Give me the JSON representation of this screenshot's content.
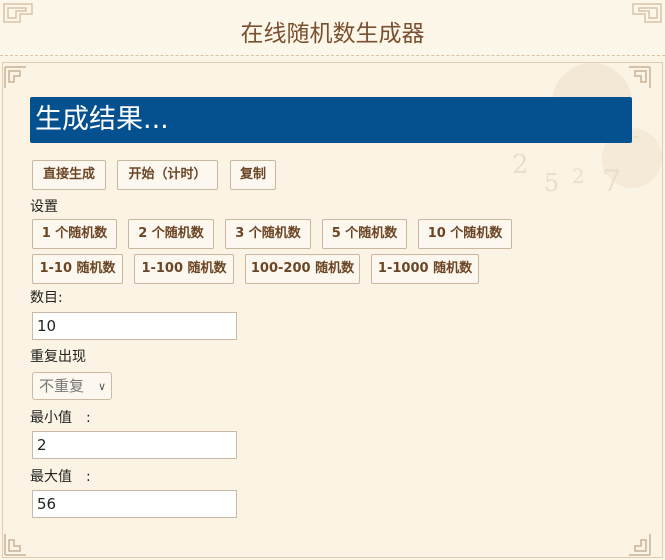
{
  "header": {
    "title": "在线随机数生成器"
  },
  "result": {
    "text": "生成结果..."
  },
  "actions": {
    "generate": "直接生成",
    "start": "开始（计时）",
    "copy": "复制"
  },
  "settings": {
    "heading": "设置",
    "count_presets": [
      "1 个随机数",
      "2 个随机数",
      "3 个随机数",
      "5 个随机数",
      "10 个随机数"
    ],
    "range_presets": [
      "1-10 随机数",
      "1-100 随机数",
      "100-200 随机数",
      "1-1000 随机数"
    ]
  },
  "form": {
    "count_label": "数目:",
    "count_value": "10",
    "repeat_label": "重复出现",
    "repeat_selected": "不重复",
    "min_label": "最小值　:",
    "min_value": "2",
    "max_label": "最大值　:",
    "max_value": "56"
  },
  "colors": {
    "result_bg": "#05508f",
    "button_text": "#6b4626",
    "title": "#7a5030"
  }
}
